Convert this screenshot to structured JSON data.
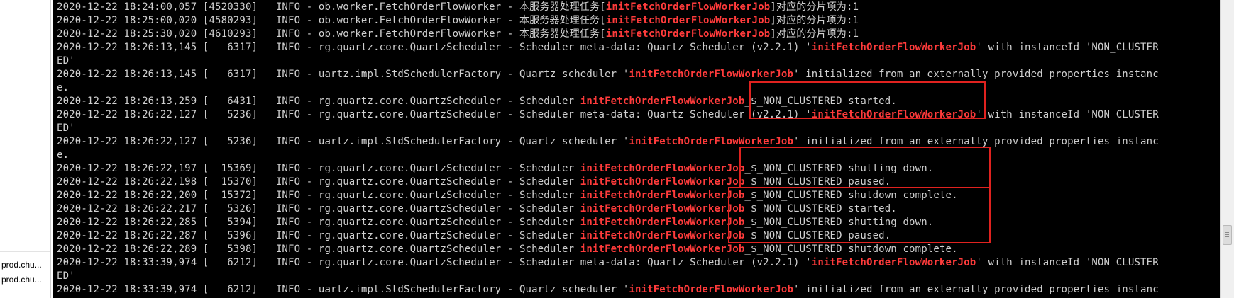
{
  "sidebar": {
    "items": [
      {
        "label": "prod.chu..."
      },
      {
        "label": "prod.chu..."
      }
    ]
  },
  "colors": {
    "terminal_bg": "#000000",
    "terminal_text": "#d0d0d0",
    "highlight": "#ff3b3b",
    "annotation": "#e0221f"
  },
  "log": {
    "lines": [
      {
        "pre": "2020-12-22 18:24:00,057 [4520330]   INFO - ob.worker.FetchOrderFlowWorker - 本服务器处理任务[",
        "hl": "initFetchOrderFlowWorkerJob",
        "post": "]对应的分片项为:1"
      },
      {
        "pre": "2020-12-22 18:25:00,020 [4580293]   INFO - ob.worker.FetchOrderFlowWorker - 本服务器处理任务[",
        "hl": "initFetchOrderFlowWorkerJob",
        "post": "]对应的分片项为:1"
      },
      {
        "pre": "2020-12-22 18:25:30,020 [4610293]   INFO - ob.worker.FetchOrderFlowWorker - 本服务器处理任务[",
        "hl": "initFetchOrderFlowWorkerJob",
        "post": "]对应的分片项为:1"
      },
      {
        "pre": "2020-12-22 18:26:13,145 [   6317]   INFO - rg.quartz.core.QuartzScheduler - Scheduler meta-data: Quartz Scheduler (v2.2.1) '",
        "hl": "initFetchOrderFlowWorkerJob",
        "post": "' with instanceId 'NON_CLUSTER"
      },
      {
        "pre": "ED'",
        "hl": "",
        "post": ""
      },
      {
        "pre": "2020-12-22 18:26:13,145 [   6317]   INFO - uartz.impl.StdSchedulerFactory - Quartz scheduler '",
        "hl": "initFetchOrderFlowWorkerJob",
        "post": "' initialized from an externally provided properties instanc"
      },
      {
        "pre": "e.",
        "hl": "",
        "post": ""
      },
      {
        "pre": "2020-12-22 18:26:13,259 [   6431]   INFO - rg.quartz.core.QuartzScheduler - Scheduler ",
        "hl": "initFetchOrderFlowWorkerJob",
        "post": "_$_NON_CLUSTERED started."
      },
      {
        "pre": "2020-12-22 18:26:22,127 [   5236]   INFO - rg.quartz.core.QuartzScheduler - Scheduler meta-data: Quartz Scheduler (v2.2.1) '",
        "hl": "initFetchOrderFlowWorkerJob",
        "post": "' with instanceId 'NON_CLUSTER"
      },
      {
        "pre": "ED'",
        "hl": "",
        "post": ""
      },
      {
        "pre": "2020-12-22 18:26:22,127 [   5236]   INFO - uartz.impl.StdSchedulerFactory - Quartz scheduler '",
        "hl": "initFetchOrderFlowWorkerJob",
        "post": "' initialized from an externally provided properties instanc"
      },
      {
        "pre": "e.",
        "hl": "",
        "post": ""
      },
      {
        "pre": "2020-12-22 18:26:22,197 [  15369]   INFO - rg.quartz.core.QuartzScheduler - Scheduler ",
        "hl": "initFetchOrderFlowWorkerJob",
        "post": "_$_NON_CLUSTERED shutting down."
      },
      {
        "pre": "2020-12-22 18:26:22,198 [  15370]   INFO - rg.quartz.core.QuartzScheduler - Scheduler ",
        "hl": "initFetchOrderFlowWorkerJob",
        "post": "_$_NON_CLUSTERED paused."
      },
      {
        "pre": "2020-12-22 18:26:22,200 [  15372]   INFO - rg.quartz.core.QuartzScheduler - Scheduler ",
        "hl": "initFetchOrderFlowWorkerJob",
        "post": "_$_NON_CLUSTERED shutdown complete."
      },
      {
        "pre": "2020-12-22 18:26:22,217 [   5326]   INFO - rg.quartz.core.QuartzScheduler - Scheduler ",
        "hl": "initFetchOrderFlowWorkerJob",
        "post": "_$_NON_CLUSTERED started."
      },
      {
        "pre": "2020-12-22 18:26:22,285 [   5394]   INFO - rg.quartz.core.QuartzScheduler - Scheduler ",
        "hl": "initFetchOrderFlowWorkerJob",
        "post": "_$_NON_CLUSTERED shutting down."
      },
      {
        "pre": "2020-12-22 18:26:22,287 [   5396]   INFO - rg.quartz.core.QuartzScheduler - Scheduler ",
        "hl": "initFetchOrderFlowWorkerJob",
        "post": "_$_NON_CLUSTERED paused."
      },
      {
        "pre": "2020-12-22 18:26:22,289 [   5398]   INFO - rg.quartz.core.QuartzScheduler - Scheduler ",
        "hl": "initFetchOrderFlowWorkerJob",
        "post": "_$_NON_CLUSTERED shutdown complete."
      },
      {
        "pre": "2020-12-22 18:33:39,974 [   6212]   INFO - rg.quartz.core.QuartzScheduler - Scheduler meta-data: Quartz Scheduler (v2.2.1) '",
        "hl": "initFetchOrderFlowWorkerJob",
        "post": "' with instanceId 'NON_CLUSTER"
      },
      {
        "pre": "ED'",
        "hl": "",
        "post": ""
      },
      {
        "pre": "2020-12-22 18:33:39,974 [   6212]   INFO - uartz.impl.StdSchedulerFactory - Quartz scheduler '",
        "hl": "initFetchOrderFlowWorkerJob",
        "post": "' initialized from an externally provided properties instanc"
      }
    ]
  }
}
